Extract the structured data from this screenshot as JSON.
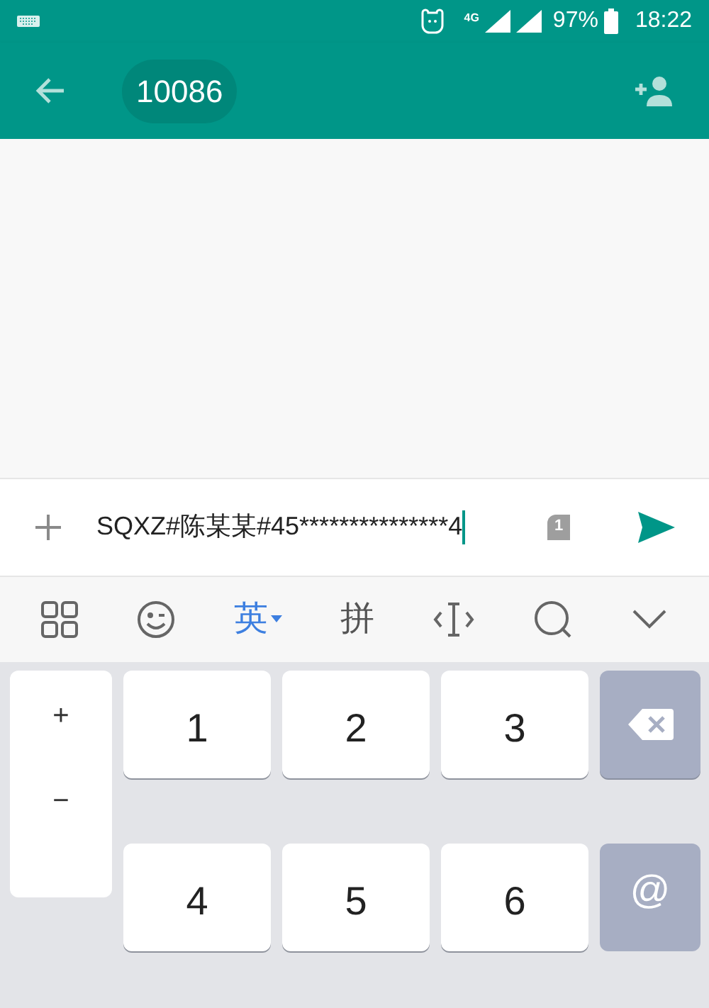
{
  "status_bar": {
    "network": "4G",
    "battery": "97%",
    "time": "18:22"
  },
  "toolbar": {
    "recipient": "10086"
  },
  "compose": {
    "value": "SQXZ#陈某某#45***************4",
    "sim": "1"
  },
  "keyboard_toolbar": {
    "language_tabs": [
      {
        "label": "英",
        "selected": true
      },
      {
        "label": "拼",
        "selected": false
      }
    ]
  },
  "keyboard": {
    "symbol_keys": [
      "+",
      "−"
    ],
    "number_rows": [
      [
        "1",
        "2",
        "3"
      ],
      [
        "4",
        "5",
        "6"
      ]
    ],
    "side_keys": [
      {
        "kind": "backspace"
      },
      {
        "kind": "text",
        "label": "@"
      }
    ]
  }
}
